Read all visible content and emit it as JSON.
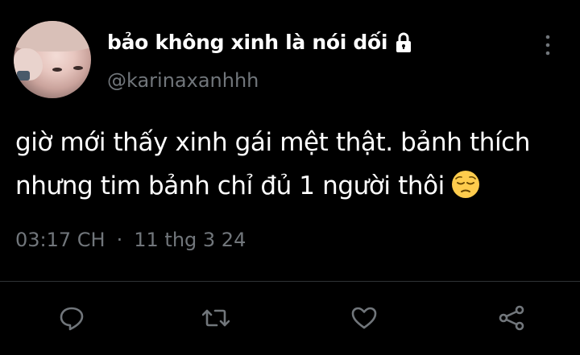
{
  "tweet": {
    "display_name": "bảo không xinh là nói dối",
    "handle": "@karinaxanhhh",
    "text_lines": [
      "giờ mới thấy xinh gái mệt thật. bảnh thích",
      "nhưng tim bảnh chỉ đủ 1 người thôi"
    ],
    "time": "03:17 CH",
    "separator": "·",
    "date": "11 thg 3 24"
  },
  "icons": {
    "lock": "lock-icon",
    "more": "more-vertical-icon",
    "emoji": "pensive-face-emoji",
    "reply": "reply-icon",
    "retweet": "retweet-icon",
    "like": "heart-icon",
    "share": "share-icon"
  },
  "colors": {
    "background": "#000000",
    "text": "#ffffff",
    "muted": "#71767b",
    "divider": "#2f3336"
  }
}
